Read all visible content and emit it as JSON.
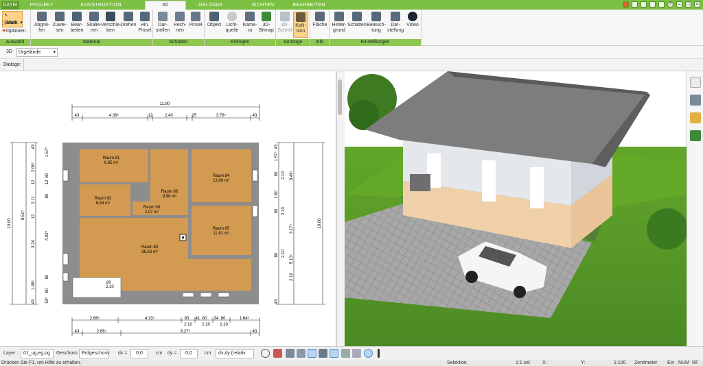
{
  "tabs": [
    "DATEI",
    "PROJEKT",
    "KONSTRUKTION",
    "3D",
    "GELÄNDE",
    "SICHTEN",
    "BEARBEITEN"
  ],
  "ribbon": {
    "auswahl": {
      "label": "Auswahl",
      "items": [
        "Selekt",
        "Mark.",
        "Optionen"
      ]
    },
    "material": {
      "label": "Material",
      "buttons": [
        "Abgrei-\nfen",
        "Zuwei-\nsen",
        "Bear-\nbeiten",
        "Skalie-\nren",
        "Verschie-\nben",
        "Drehen",
        "Hin.\nPinsel"
      ]
    },
    "schatten": {
      "label": "Schatten",
      "buttons": [
        "Dar-\nstellen",
        "Rech-\nnen",
        "Pinsel"
      ]
    },
    "einfuegen": {
      "label": "Einfügen",
      "buttons": [
        "Objekt",
        "Licht-\nquelle",
        "Kame-\nra",
        "3D-\nBitmap"
      ]
    },
    "sonstige": {
      "label": "Sonstige",
      "buttons": [
        "3D-\nSchnitt",
        "Kolli-\nsion"
      ]
    },
    "info": {
      "label": "Info",
      "buttons": [
        "Fläche"
      ]
    },
    "einstellungen": {
      "label": "Einstellungen",
      "buttons": [
        "Hinter-\ngrund",
        "Schatten",
        "Beleuch-\ntung",
        "Dar-\nstellung",
        "Video"
      ]
    }
  },
  "view_row": {
    "mode": "3D",
    "terrain": "Urgelände"
  },
  "dialoge_label": "Dialoge:",
  "plan": {
    "top_dims": {
      "total": "11.80",
      "segs": [
        "43",
        "4.38⁵",
        "12",
        "2.40",
        "25",
        "3.76⁵",
        "43"
      ]
    },
    "bottom_dims": {
      "row1": [
        "2.66⁵",
        "4.33⁵",
        "80",
        "41",
        "80",
        "34",
        "80",
        "1.64⁵"
      ],
      "row1b": [
        "2.10",
        "2.10",
        "2.10"
      ],
      "row2": [
        "43",
        "2.66⁵",
        "8.27⁵",
        "43"
      ]
    },
    "left_dims": {
      "outer": "10.00",
      "inner": "8.51⁵",
      "segs": [
        "43",
        "2.06⁵",
        "12",
        "2.11",
        "12",
        "3.24",
        "1.48⁵",
        "43"
      ]
    },
    "left_dims2": [
      "1.57⁵",
      "12",
      "80",
      "80",
      "4.92⁵",
      "80",
      "80",
      "53⁵"
    ],
    "right_dims": {
      "outer": "10.00",
      "segs": [
        "43",
        "1.57⁵",
        "80",
        "3.49⁵",
        "80",
        "1.60",
        "3.17⁵",
        "5.10⁵",
        "80",
        "2.10",
        "43"
      ]
    },
    "right_dims_inner": [
      "2.10",
      "2.10",
      "2.10"
    ],
    "door_marks": [
      "80",
      "2.10"
    ],
    "rooms": [
      {
        "name": "Raum 91",
        "area": "6,85 m²"
      },
      {
        "name": "Raum 92",
        "area": "6,84 m²"
      },
      {
        "name": "Raum 86",
        "area": "9,98 m²"
      },
      {
        "name": "Raum 90",
        "area": "2,07 m²"
      },
      {
        "name": "Raum 84",
        "area": "13,00 m²"
      },
      {
        "name": "Raum 85",
        "area": "11,81 m²"
      },
      {
        "name": "Raum 83",
        "area": "36,53 m²"
      }
    ]
  },
  "bottom": {
    "layer_label": "Layer :",
    "layer_value": "01_ug,eg,og",
    "geschoss_label": "Geschoss :",
    "geschoss_value": "Erdgeschoss",
    "dx_label": "dx =",
    "dx_value": "0,0",
    "dx_unit": "cm",
    "dy_label": "dy =",
    "dy_value": "0,0",
    "dy_unit": "cm",
    "mode_value": "dx,dy (relativ ke"
  },
  "status": {
    "hint": "Drücken Sie F1, um Hilfe zu erhalten.",
    "mode": "Selektion",
    "sel": "1:1 sel",
    "x": "X:",
    "y": "Y:",
    "scale": "1:100",
    "unit": "Zentimeter",
    "ein": "Ein",
    "num": "NUM",
    "rf": "RF"
  }
}
